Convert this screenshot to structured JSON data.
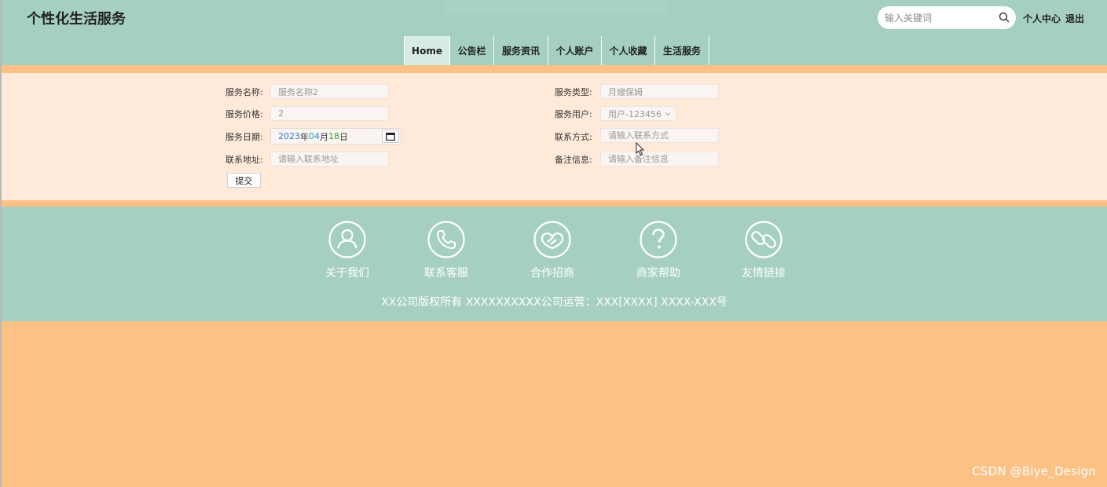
{
  "header": {
    "site_title": "个性化生活服务",
    "search_placeholder": "输入关键词",
    "user_center": "个人中心",
    "logout": "退出"
  },
  "nav": {
    "items": [
      {
        "label": "Home",
        "active": true
      },
      {
        "label": "公告栏"
      },
      {
        "label": "服务资讯"
      },
      {
        "label": "个人账户"
      },
      {
        "label": "个人收藏"
      },
      {
        "label": "生活服务"
      }
    ]
  },
  "form": {
    "service_name": {
      "label": "服务名称:",
      "value": "服务名称2"
    },
    "service_type": {
      "label": "服务类型:",
      "value": "月嫂保姆"
    },
    "service_price": {
      "label": "服务价格:",
      "value": "2"
    },
    "service_user": {
      "label": "服务用户:",
      "value": "用户-123456"
    },
    "service_date": {
      "label": "服务日期:",
      "year": "2023",
      "year_unit": "年",
      "month": "04",
      "month_unit": "月",
      "day": "18",
      "day_unit": "日"
    },
    "contact": {
      "label": "联系方式:",
      "placeholder": "请输入联系方式"
    },
    "address": {
      "label": "联系地址:",
      "placeholder": "请输入联系地址"
    },
    "remark": {
      "label": "备注信息:",
      "placeholder": "请输入备注信息"
    },
    "submit": "提交"
  },
  "footer": {
    "links": [
      {
        "label": "关于我们",
        "icon": "user-icon"
      },
      {
        "label": "联系客服",
        "icon": "phone-icon"
      },
      {
        "label": "合作招商",
        "icon": "handshake-icon"
      },
      {
        "label": "商家帮助",
        "icon": "question-icon"
      },
      {
        "label": "友情链接",
        "icon": "link-icon"
      }
    ],
    "copyright": "XX公司版权所有 XXXXXXXXXX公司运营：XXX[XXXX] XXXX-XXX号"
  },
  "watermark": "CSDN @Biye_Design",
  "colors": {
    "header_bg": "#a5cfc3",
    "page_bg": "#fcc185",
    "form_bg": "#ffeada",
    "nav_active": "#d7ebe5"
  }
}
